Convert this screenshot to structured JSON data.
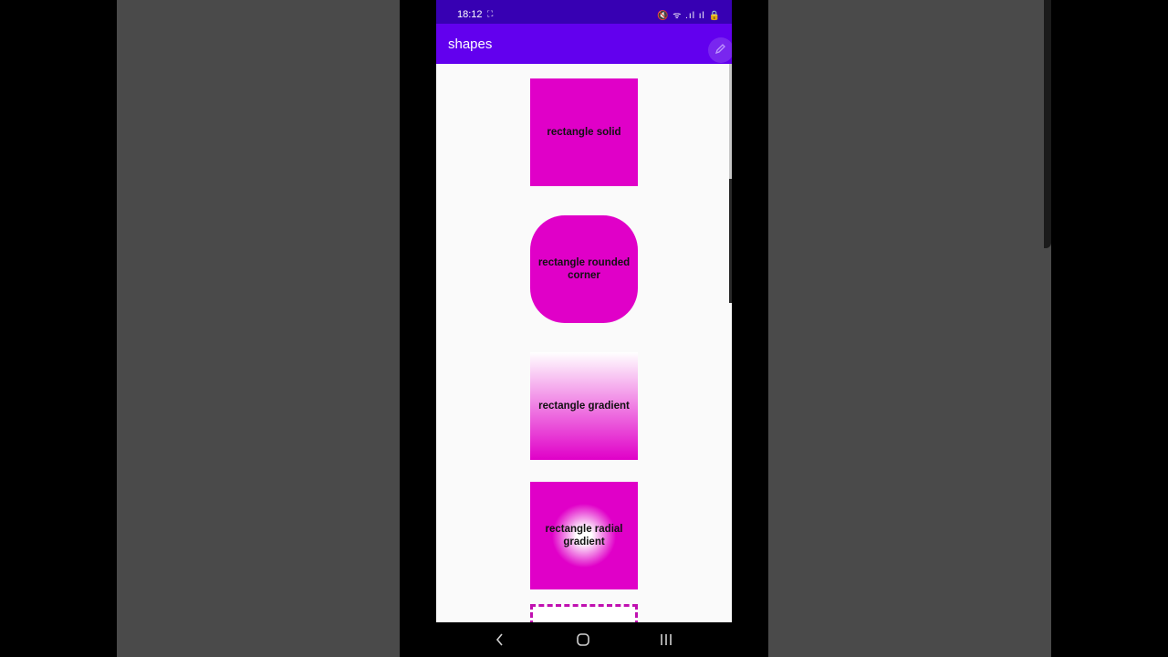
{
  "status_bar": {
    "time": "18:12",
    "notification_dots": "⛶",
    "status_icons": "🔇 ᯤ .ıl ıl 🔒"
  },
  "app_bar": {
    "title": "shapes",
    "edit_icon": "pencil-icon"
  },
  "shapes": {
    "solid": {
      "label": "rectangle solid",
      "color": "#e000c8"
    },
    "rounded": {
      "label": "rectangle rounded corner",
      "color": "#e000c8"
    },
    "gradient": {
      "label": "rectangle gradient",
      "start_color": "#ffffff",
      "end_color": "#e000c8"
    },
    "radial": {
      "label": "rectangle radial gradient",
      "center_color": "#ffffff",
      "edge_color": "#e000c8"
    },
    "dashed": {
      "stroke_color": "#c010b0"
    }
  },
  "nav_bar": {
    "back_icon": "back-chevron-icon",
    "home_icon": "home-icon",
    "recents_icon": "recents-icon"
  },
  "colors": {
    "status_bar": "#3700b3",
    "app_bar": "#6200ee",
    "background": "#fafafa",
    "outer_panels": "#4a4a4a"
  }
}
